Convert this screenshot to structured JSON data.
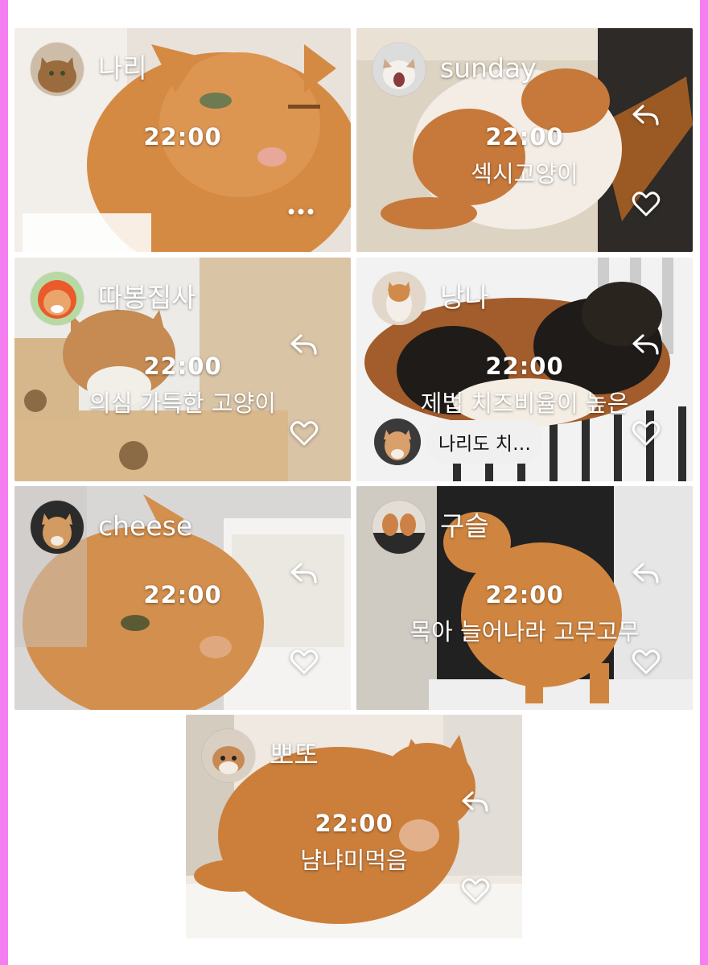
{
  "posts": [
    {
      "name": "나리",
      "time": "22:00",
      "caption": "",
      "action": "more",
      "colors": {
        "bg": "#e8e2da",
        "cat": "#d58a44",
        "dark": "#9a5a28"
      }
    },
    {
      "name": "sunday",
      "time": "22:00",
      "caption": "섹시고양이",
      "action": "reply",
      "colors": {
        "bg": "#e9e1d3",
        "cat": "#f3ede5",
        "dark": "#c6793a"
      }
    },
    {
      "name": "따봉집사",
      "time": "22:00",
      "caption": "의심 가득한 고양이",
      "action": "reply",
      "colors": {
        "bg": "#d9c4a6",
        "cat": "#c58b52",
        "dark": "#f2efe9"
      }
    },
    {
      "name": "낭나",
      "time": "22:00",
      "caption": "제법 치즈비율이 높은",
      "action": "reply",
      "comment": "나리도 치…",
      "colors": {
        "bg": "#f2f2f2",
        "cat": "#a35c2b",
        "dark": "#1f1b18"
      }
    },
    {
      "name": "cheese",
      "time": "22:00",
      "caption": "",
      "action": "reply",
      "colors": {
        "bg": "#d8d7d6",
        "cat": "#d38f4d",
        "dark": "#9b5c29"
      }
    },
    {
      "name": "구슬",
      "time": "22:00",
      "caption": "목아 늘어나라 고무고무",
      "action": "reply",
      "colors": {
        "bg": "#b7b3ad",
        "cat": "#cf8540",
        "dark": "#212121"
      }
    },
    {
      "name": "뽀또",
      "time": "22:00",
      "caption": "냠냐미먹음",
      "action": "reply",
      "colors": {
        "bg": "#efe9e1",
        "cat": "#cc7f3b",
        "dark": "#8e531f"
      }
    }
  ],
  "frame_color": "#f57ff0"
}
